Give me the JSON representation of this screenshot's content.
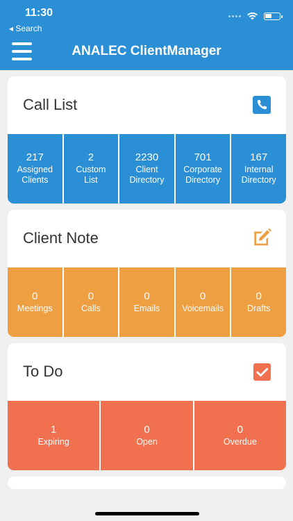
{
  "status": {
    "time": "11:30",
    "back_label": "◂ Search"
  },
  "header": {
    "title": "ANALEC ClientManager"
  },
  "call_list": {
    "title": "Call List",
    "icon": "phone-icon",
    "tiles": [
      {
        "count": "217",
        "label": "Assigned\nClients"
      },
      {
        "count": "2",
        "label": "Custom\nList"
      },
      {
        "count": "2230",
        "label": "Client\nDirectory"
      },
      {
        "count": "701",
        "label": "Corporate\nDirectory"
      },
      {
        "count": "167",
        "label": "Internal\nDirectory"
      }
    ]
  },
  "client_note": {
    "title": "Client Note",
    "icon": "edit-note-icon",
    "tiles": [
      {
        "count": "0",
        "label": "Meetings"
      },
      {
        "count": "0",
        "label": "Calls"
      },
      {
        "count": "0",
        "label": "Emails"
      },
      {
        "count": "0",
        "label": "Voicemails"
      },
      {
        "count": "0",
        "label": "Drafts"
      }
    ]
  },
  "todo": {
    "title": "To Do",
    "icon": "checkbox-checked-icon",
    "tiles": [
      {
        "count": "1",
        "label": "Expiring"
      },
      {
        "count": "0",
        "label": "Open"
      },
      {
        "count": "0",
        "label": "Overdue"
      }
    ]
  },
  "colors": {
    "header": "#2b8fd6",
    "call_list": "#2b8fd6",
    "client_note": "#ed9f42",
    "todo": "#f0704f"
  }
}
